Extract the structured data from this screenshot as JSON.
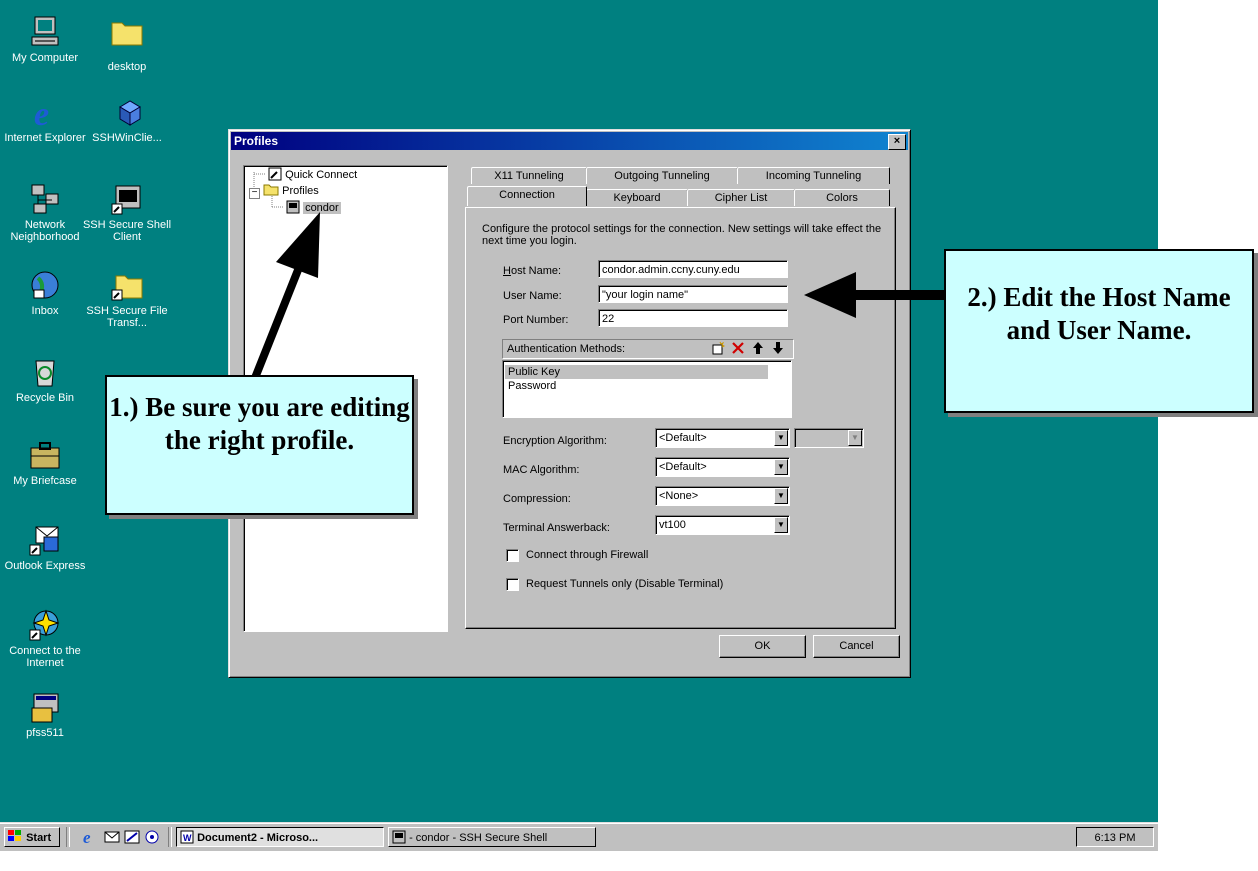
{
  "desktop": {
    "icons": [
      {
        "label": "My Computer"
      },
      {
        "label": "desktop"
      },
      {
        "label": "Internet Explorer"
      },
      {
        "label": "SSHWinClie..."
      },
      {
        "label": "Network Neighborhood"
      },
      {
        "label": "SSH Secure Shell Client"
      },
      {
        "label": "Inbox"
      },
      {
        "label": "SSH Secure File Transf..."
      },
      {
        "label": "Recycle Bin"
      },
      {
        "label": "My Briefcase"
      },
      {
        "label": "Outlook Express"
      },
      {
        "label": "Connect to the Internet"
      },
      {
        "label": "pfss511"
      }
    ]
  },
  "dialog": {
    "title": "Profiles",
    "close": "×",
    "tree": {
      "quick_connect": "Quick Connect",
      "profiles": "Profiles",
      "profile": "condor",
      "expander": "−"
    },
    "tabs_back": [
      "X11 Tunneling",
      "Outgoing Tunneling",
      "Incoming Tunneling"
    ],
    "tabs_front": [
      "Connection",
      "Keyboard",
      "Cipher List",
      "Colors"
    ],
    "description": "Configure the protocol settings for the connection. New settings will take effect the next time you login.",
    "fields": {
      "host_label": "Host Name:",
      "host_value": "condor.admin.ccny.cuny.edu",
      "user_label": "User Name:",
      "user_value": "\"your login name\"",
      "port_label": "Port Number:",
      "port_value": "22"
    },
    "auth": {
      "label": "Authentication Methods:",
      "methods": [
        "Public Key",
        "Password"
      ]
    },
    "combos": {
      "encryption_label": "Encryption Algorithm:",
      "encryption_value": "<Default>",
      "mac_label": "MAC Algorithm:",
      "mac_value": "<Default>",
      "compression_label": "Compression:",
      "compression_value": "<None>",
      "terminal_label": "Terminal Answerback:",
      "terminal_value": "vt100"
    },
    "checks": {
      "firewall": "Connect through Firewall",
      "tunnels": "Request Tunnels only (Disable Terminal)"
    },
    "buttons": {
      "ok": "OK",
      "cancel": "Cancel"
    }
  },
  "callouts": {
    "one": "1.) Be sure you are editing the right profile.",
    "two": "2.) Edit the Host Name and User Name."
  },
  "taskbar": {
    "start": "Start",
    "tasks": [
      "Document2 - Microso...",
      "- condor - SSH Secure Shell"
    ],
    "clock": "6:13 PM"
  },
  "colors": {
    "desktop": "#008080",
    "titlebar": "#000080",
    "callout_fill": "#ccffff"
  }
}
